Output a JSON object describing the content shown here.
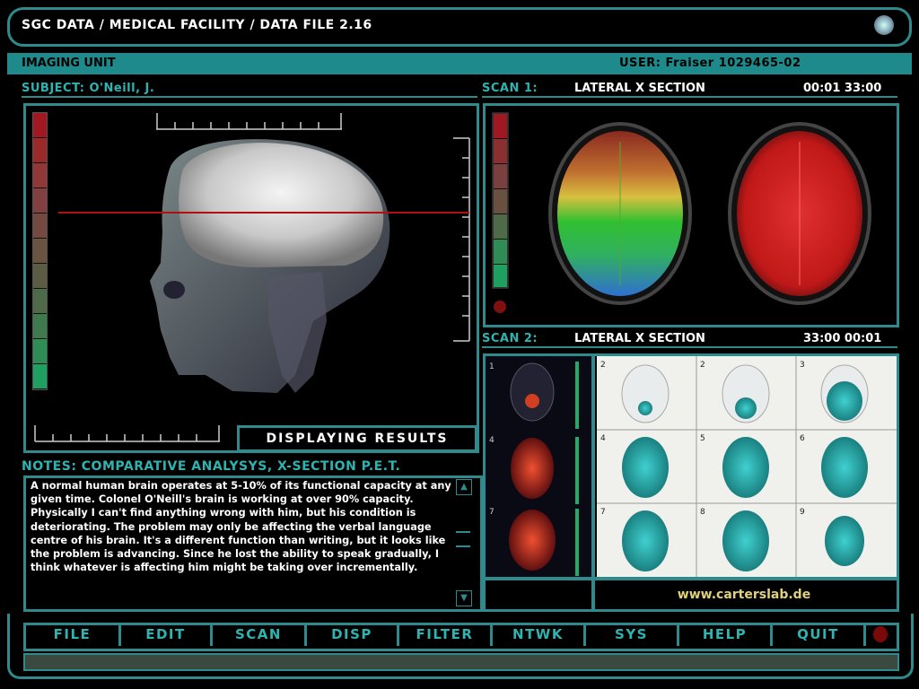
{
  "header": {
    "title": "SGC DATA / MEDICAL FACILITY / DATA FILE 2.16"
  },
  "infobar": {
    "unit": "IMAGING UNIT",
    "user": "USER: Fraiser 1029465-02"
  },
  "subject": {
    "label": "SUBJECT: O'Neill, J."
  },
  "scan1": {
    "label": "SCAN 1:",
    "section": "LATERAL X SECTION",
    "time": "00:01 33:00"
  },
  "scan2": {
    "label": "SCAN 2:",
    "section": "LATERAL X SECTION",
    "time": "33:00 00:01",
    "slice_numbers": [
      "1",
      "4",
      "7",
      "2",
      "3",
      "4",
      "5",
      "6",
      "7",
      "8",
      "9"
    ]
  },
  "status": {
    "displaying": "DISPLAYING RESULTS"
  },
  "notes": {
    "heading": "NOTES: COMPARATIVE ANALYSYS,  X-SECTION P.E.T.",
    "paragraph1": "A normal human brain operates at 5-10% of its functional capacity at any given time. Colonel O'Neill's brain is working at over 90% capacity.",
    "paragraph2": "Physically I can't find anything wrong with him, but his condition is deteriorating. The problem may only be affecting the verbal language centre of his brain. It's a different function than writing, but it looks like the problem is advancing. Since he lost the ability to speak gradually, I think whatever is affecting him might be taking over incrementally."
  },
  "credit": "www.carterslab.de",
  "menu": [
    "FILE",
    "EDIT",
    "SCAN",
    "DISP",
    "FILTER",
    "NTWK",
    "SYS",
    "HELP",
    "QUIT"
  ],
  "colors": {
    "accent": "#2e8a8c",
    "teal_text": "#2fb3b0",
    "credit": "#e0d27a"
  }
}
